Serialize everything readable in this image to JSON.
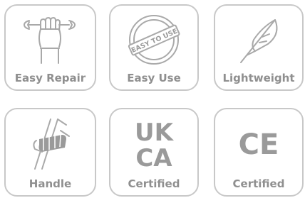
{
  "cards": [
    {
      "label": "Easy Repair",
      "icon": "wrench-fist-icon"
    },
    {
      "label": "Easy Use",
      "icon": "easy-to-use-stamp-icon",
      "stamp_text": "EASY TO USE"
    },
    {
      "label": "Lightweight",
      "icon": "feather-icon"
    },
    {
      "label": "Handle",
      "icon": "hand-grip-icon"
    },
    {
      "label": "Certified",
      "icon": "ukca-mark-icon",
      "mark_line1": "UK",
      "mark_line2": "CA"
    },
    {
      "label": "Certified",
      "icon": "ce-mark-icon",
      "mark_text": "CE"
    }
  ],
  "colors": {
    "border": "#c8c8c8",
    "icon": "#a9a9a9",
    "text": "#8f8f8f"
  }
}
